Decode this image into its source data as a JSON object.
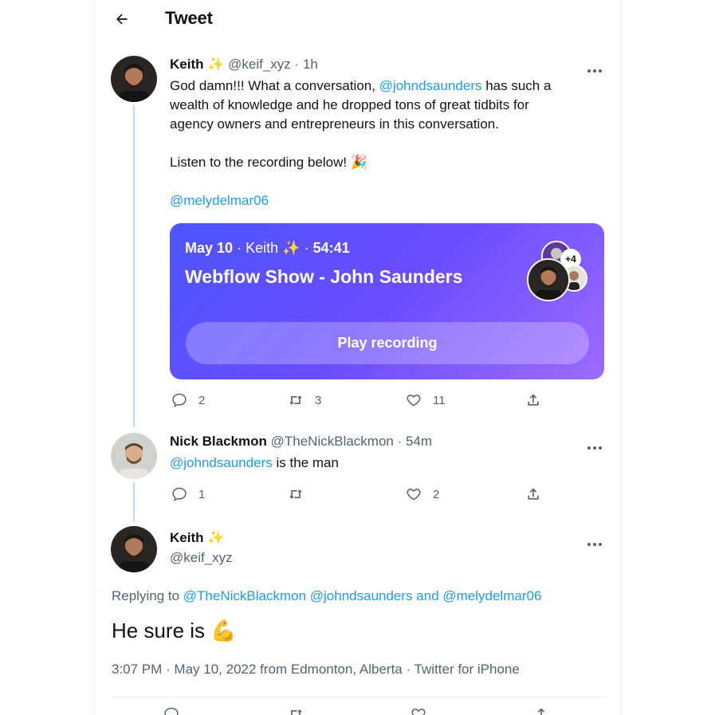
{
  "header": {
    "title": "Tweet"
  },
  "tweet1": {
    "name": "Keith",
    "name_emoji": "✨",
    "handle": "@keif_xyz",
    "sep": "·",
    "time": "1h",
    "line1_a": "God damn!!! What a conversation, ",
    "mention1": "@johndsaunders",
    "line1_b": " has such a",
    "line2": "wealth of knowledge and he dropped tons of great tidbits for",
    "line3": "agency owners and entrepreneurs in this conversation.",
    "line4": "Listen to the recording below! 🎉",
    "mention2": "@melydelmar06",
    "space": {
      "date": "May 10",
      "host": "Keith",
      "host_emoji": "✨",
      "duration": "54:41",
      "title": "Webflow Show - John Saunders",
      "participants_extra": "+4",
      "play_label": "Play recording"
    },
    "actions": {
      "replies": "2",
      "retweets": "3",
      "likes": "11"
    }
  },
  "tweet2": {
    "name": "Nick Blackmon",
    "handle": "@TheNickBlackmon",
    "sep": "·",
    "time": "54m",
    "mention": "@johndsaunders",
    "text": " is the man",
    "actions": {
      "replies": "1",
      "retweets": "",
      "likes": "2"
    }
  },
  "tweet3": {
    "name": "Keith",
    "name_emoji": "✨",
    "handle": "@keif_xyz",
    "replying_label": "Replying to ",
    "reply_mention1": "@TheNickBlackmon",
    "reply_mention2": "@johndsaunders",
    "reply_and": " and ",
    "reply_mention3": "@melydelmar06",
    "text": "He sure is 💪",
    "meta": "3:07 PM · May 10, 2022 from Edmonton, Alberta · Twitter for iPhone"
  },
  "colors": {
    "accent": "#1d9bf0",
    "muted": "#536471",
    "card_start": "#4d54ff",
    "card_end": "#9d6bff"
  }
}
